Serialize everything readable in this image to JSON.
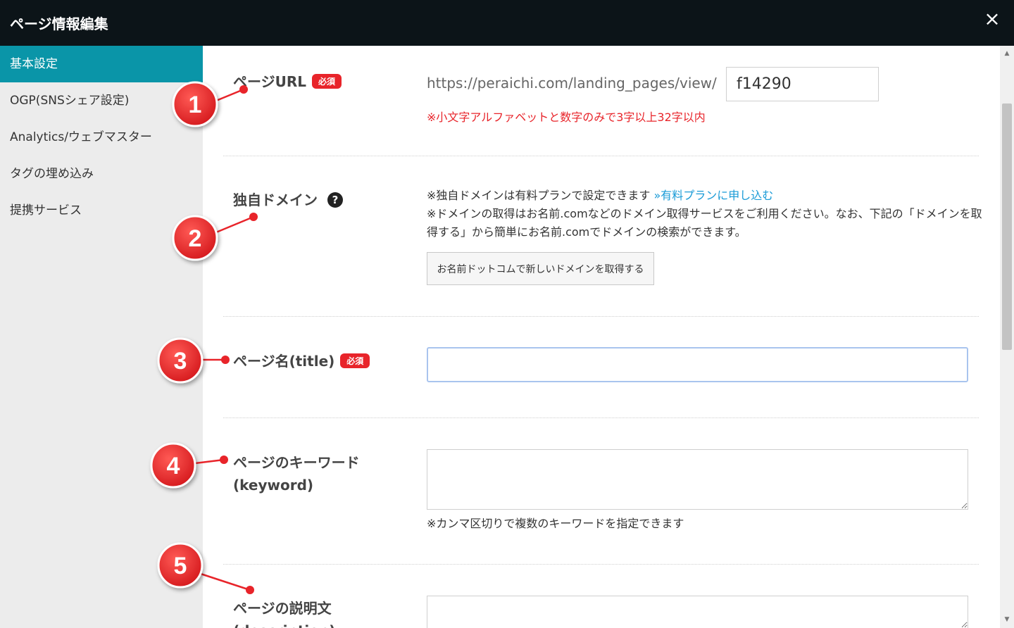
{
  "header": {
    "title": "ページ情報編集",
    "close_label": "×"
  },
  "sidebar": {
    "items": [
      {
        "label": "基本設定",
        "active": true
      },
      {
        "label": "OGP(SNSシェア設定)"
      },
      {
        "label": "Analytics/ウェブマスター"
      },
      {
        "label": "タグの埋め込み"
      },
      {
        "label": "提携サービス"
      }
    ]
  },
  "sections": {
    "url": {
      "label": "ページURL",
      "badge": "必須",
      "prefix": "https://peraichi.com/landing_pages/view/",
      "value": "f14290",
      "note": "※小文字アルファベットと数字のみで3字以上32字以内"
    },
    "domain": {
      "label": "独自ドメイン",
      "help_icon": "?",
      "note1": "※独自ドメインは有料プランで設定できます",
      "link": "»有料プランに申し込む",
      "note2": "※ドメインの取得はお名前.comなどのドメイン取得サービスをご利用ください。なお、下記の「ドメインを取",
      "note3": "得する」から簡単にお名前.comでドメインの検索ができます。",
      "button": "お名前ドットコムで新しいドメインを取得する"
    },
    "title": {
      "label": "ページ名(title)",
      "badge": "必須",
      "value": "",
      "placeholder": ""
    },
    "keyword": {
      "label1": "ページのキーワード",
      "label2": "(keyword)",
      "value": "",
      "note": "※カンマ区切りで複数のキーワードを指定できます"
    },
    "description": {
      "label1": "ページの説明文",
      "label2": "(description)",
      "value": ""
    }
  },
  "annotations": {
    "markers": [
      "1",
      "2",
      "3",
      "4",
      "5"
    ],
    "color": "#e8242a"
  }
}
